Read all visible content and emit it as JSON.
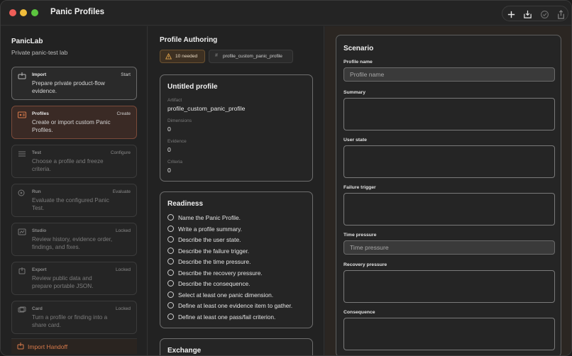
{
  "window": {
    "title": "Panic Profiles"
  },
  "toolbar": {
    "icons": [
      "plus-icon",
      "import-icon",
      "check-circle-icon",
      "share-icon"
    ]
  },
  "sidebar": {
    "app_name": "PanicLab",
    "app_subtitle": "Private panic-test lab",
    "steps": [
      {
        "title": "Import",
        "tag": "Start",
        "desc": "Prepare private product-flow evidence."
      },
      {
        "title": "Profiles",
        "tag": "Create",
        "desc": "Create or import custom Panic Profiles."
      },
      {
        "title": "Test",
        "tag": "Configure",
        "desc": "Choose a profile and freeze criteria."
      },
      {
        "title": "Run",
        "tag": "Evaluate",
        "desc": "Evaluate the configured Panic Test."
      },
      {
        "title": "Studio",
        "tag": "Locked",
        "desc": "Review history, evidence order, findings, and fixes."
      },
      {
        "title": "Export",
        "tag": "Locked",
        "desc": "Review public data and prepare portable JSON."
      },
      {
        "title": "Card",
        "tag": "Locked",
        "desc": "Turn a profile or finding into a share card."
      }
    ],
    "handoff_label": "Import Handoff"
  },
  "middle": {
    "title": "Profile Authoring",
    "needed_chip": "10 needed",
    "slug_chip": "profile_custom_panic_profile",
    "profile_card": {
      "title": "Untitled profile",
      "artifact_key": "Artifact",
      "artifact_val": "profile_custom_panic_profile",
      "dimensions_key": "Dimensions",
      "dimensions_val": "0",
      "evidence_key": "Evidence",
      "evidence_val": "0",
      "criteria_key": "Criteria",
      "criteria_val": "0"
    },
    "readiness": {
      "title": "Readiness",
      "items": [
        "Name the Panic Profile.",
        "Write a profile summary.",
        "Describe the user state.",
        "Describe the failure trigger.",
        "Describe the time pressure.",
        "Describe the recovery pressure.",
        "Describe the consequence.",
        "Select at least one panic dimension.",
        "Define at least one evidence item to gather.",
        "Define at least one pass/fail criterion."
      ]
    },
    "exchange_title": "Exchange"
  },
  "scenario": {
    "title": "Scenario",
    "profile_name_label": "Profile name",
    "profile_name_placeholder": "Profile name",
    "summary_label": "Summary",
    "user_state_label": "User state",
    "failure_trigger_label": "Failure trigger",
    "time_pressure_label": "Time pressure",
    "time_pressure_placeholder": "Time pressure",
    "recovery_pressure_label": "Recovery pressure",
    "consequence_label": "Consequence"
  },
  "colors": {
    "accent": "#d87a4a",
    "warning_chip": "#3d3022"
  }
}
